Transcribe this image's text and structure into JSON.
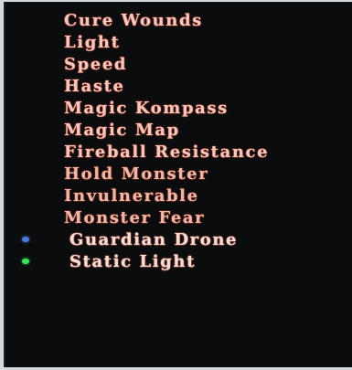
{
  "spell_menu": {
    "items": [
      {
        "label": "Cure Wounds"
      },
      {
        "label": "Light"
      },
      {
        "label": "Speed"
      },
      {
        "label": "Haste"
      },
      {
        "label": "Magic Kompass"
      },
      {
        "label": "Magic Map"
      },
      {
        "label": "Fireball Resistance"
      },
      {
        "label": "Hold Monster"
      },
      {
        "label": "Invulnerable"
      },
      {
        "label": "Monster Fear"
      },
      {
        "label": "Guardian Drone",
        "marker": "blue-orb-icon",
        "marker_color": "#4a78d8"
      },
      {
        "label": "Static Light",
        "marker": "green-orb-icon",
        "marker_color": "#39e45a"
      }
    ]
  },
  "colors": {
    "menu_background": "#0b0c0d",
    "text_glow": "#ff6d3e",
    "page_background": "#d3d9dc"
  }
}
